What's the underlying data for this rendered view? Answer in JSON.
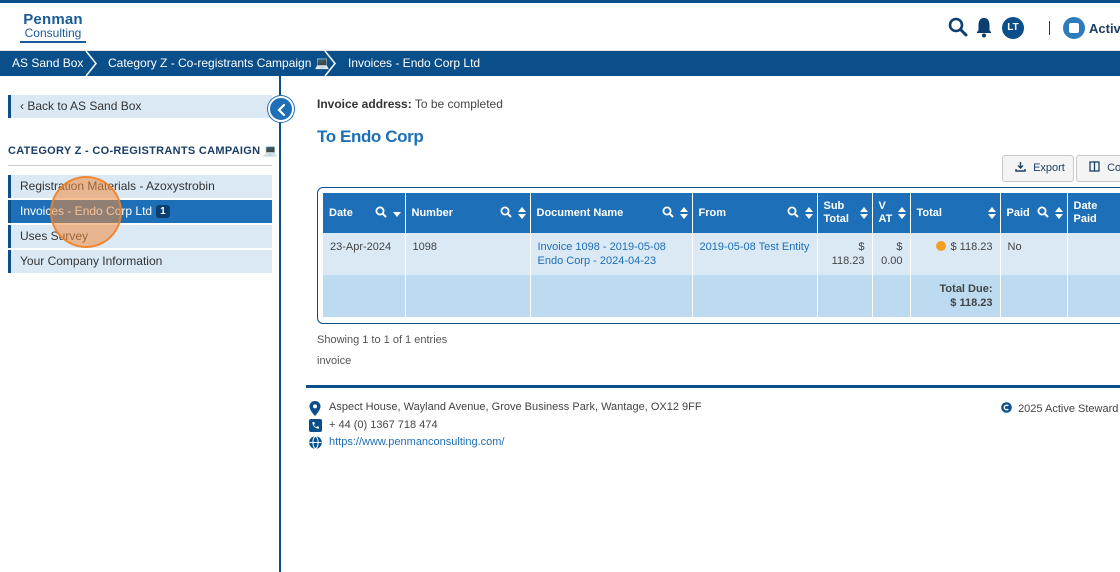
{
  "app": {
    "logo_line1": "Penman",
    "logo_line2": "Consulting",
    "brand": "Active",
    "avatar_initials": "LT"
  },
  "colors": {
    "primary": "#0b4f8a",
    "accent": "#1d6fb8",
    "row_bg": "#dbe9f5",
    "status_dot": "#f0a020"
  },
  "icons": [
    "search-icon",
    "bell-icon",
    "chevron-left-icon",
    "export-icon",
    "columns-icon",
    "sort-icon",
    "location-icon",
    "phone-icon",
    "globe-icon",
    "copyright-icon"
  ],
  "breadcrumb": [
    {
      "label": "AS Sand Box"
    },
    {
      "label": "Category Z - Co-registrants Campaign 💻"
    },
    {
      "label": "Invoices - Endo Corp Ltd"
    }
  ],
  "sidebar": {
    "back_label": "Back to AS Sand Box",
    "section_title": "CATEGORY Z - CO-REGISTRANTS CAMPAIGN 💻",
    "items": [
      {
        "label": "Registration Materials - Azoxystrobin"
      },
      {
        "label": "Invoices - Endo Corp Ltd",
        "badge": "1",
        "active": true
      },
      {
        "label": "Uses Survey"
      },
      {
        "label": "Your Company Information"
      }
    ]
  },
  "main": {
    "invoice_address_label": "Invoice address:",
    "invoice_address_value": "To be completed",
    "title": "To Endo Corp",
    "buttons": {
      "export": "Export",
      "columns": "Col"
    }
  },
  "table": {
    "columns": [
      "Date",
      "Number",
      "Document Name",
      "From",
      "Sub Total",
      "VAT",
      "Total",
      "Paid",
      "Date Paid"
    ],
    "rows": [
      {
        "date": "23-Apr-2024",
        "number": "1098",
        "document_name": "Invoice 1098 - 2019-05-08 Endo Corp - 2024-04-23",
        "from": "2019-05-08 Test Entity",
        "sub_total": "$ 118.23",
        "vat_symbol": "$",
        "vat_value": "0.00",
        "total": "$ 118.23",
        "paid": "No",
        "date_paid": ""
      }
    ],
    "total_due_label": "Total Due:",
    "total_due_value": "$ 118.23",
    "showing": "Showing 1 to 1 of 1 entries",
    "caption": "invoice"
  },
  "footer": {
    "address": "Aspect House, Wayland Avenue, Grove Business Park, Wantage, OX12 9FF",
    "phone": "+ 44 (0) 1367 718 474",
    "website": "https://www.penmanconsulting.com/",
    "copyright": "2025 Active Steward"
  }
}
